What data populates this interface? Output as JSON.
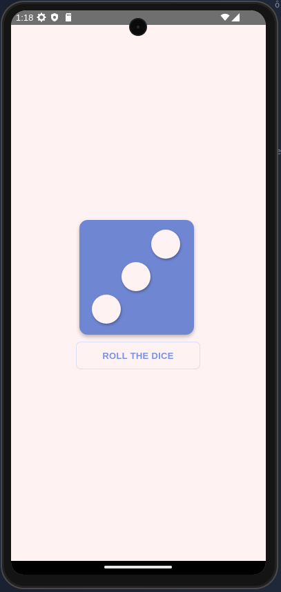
{
  "status_bar": {
    "time": "1:18",
    "icons": [
      "gear-icon",
      "shield-icon",
      "sd-card-icon",
      "wifi-icon",
      "signal-icon"
    ]
  },
  "dice": {
    "face_value": 3,
    "color": "#6f86d3",
    "pip_color": "#fff2f2"
  },
  "roll_button": {
    "label": "ROLL THE DICE",
    "text_color": "#7b93e2"
  },
  "colors": {
    "screen_background": "#fff2f2",
    "status_bar": "#6f6f6f",
    "nav_bar": "#000000"
  }
}
